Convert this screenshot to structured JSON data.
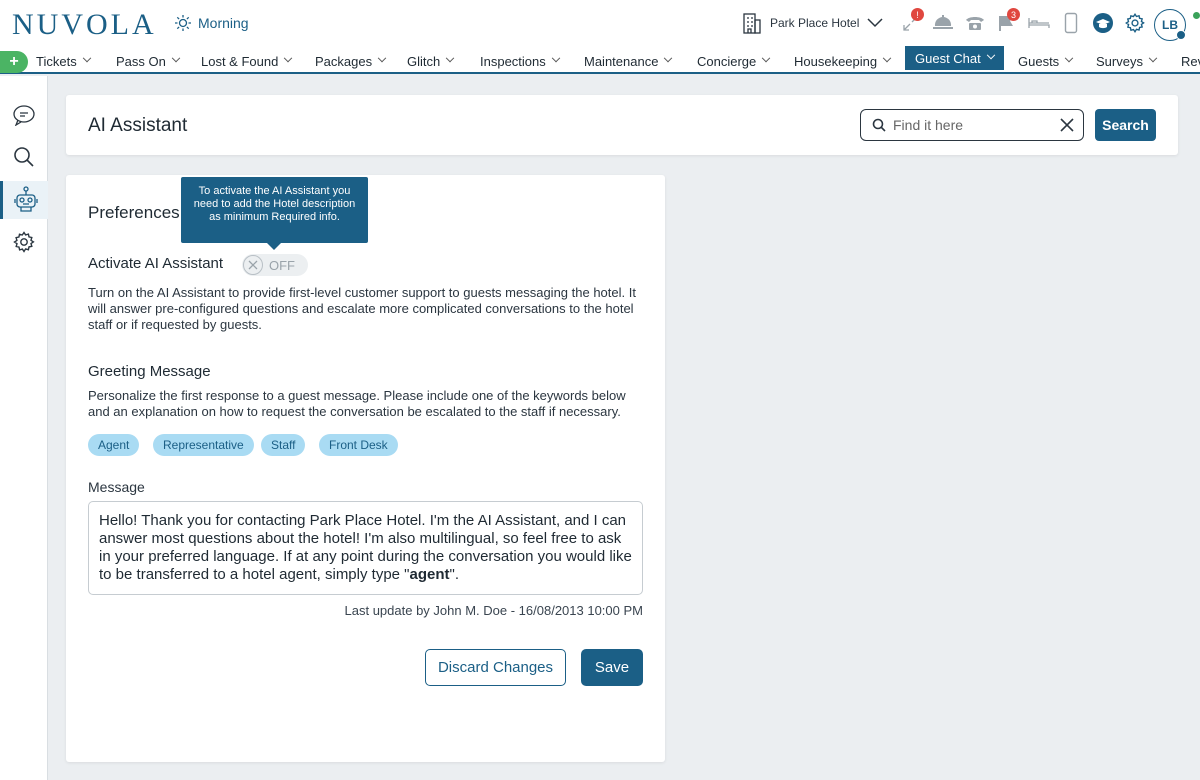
{
  "app": {
    "logo": "NUVOLA",
    "shift": "Morning",
    "hotel": "Park Place Hotel",
    "avatar_initials": "LB"
  },
  "badges": {
    "alerts": "!",
    "messages": "3"
  },
  "nav": {
    "items": [
      "Tickets",
      "Pass On",
      "Lost & Found",
      "Packages",
      "Glitch",
      "Inspections",
      "Maintenance",
      "Concierge",
      "Housekeeping",
      "Guest Chat",
      "Guests",
      "Surveys",
      "Rev"
    ],
    "active": "Guest Chat"
  },
  "header": {
    "title": "AI Assistant",
    "search_placeholder": "Find it here",
    "search_button": "Search"
  },
  "preferences": {
    "title": "Preferences",
    "tooltip": "To activate the AI Assistant you need to add the Hotel description as minimum Required info.",
    "activate_label": "Activate AI Assistant",
    "toggle_state": "OFF",
    "description": "Turn on the AI Assistant to provide first-level customer support to guests messaging the hotel. It will answer pre-configured questions and escalate more complicated conversations to the hotel staff or if requested by guests."
  },
  "greeting": {
    "title": "Greeting Message",
    "description": "Personalize the first response to a guest message. Please include one of the keywords below and an explanation on how to request the conversation be escalated to the staff if necessary.",
    "keywords": [
      "Agent",
      "Representative",
      "Staff",
      "Front Desk"
    ],
    "message_label": "Message",
    "message_text": "Hello! Thank you for contacting Park Place Hotel. I'm the AI Assistant, and I can answer most questions about the hotel! I'm also multilingual, so feel free to ask in your preferred language. If at any point during the conversation you would like to be transferred to a hotel agent, simply type \"",
    "message_keyword": "agent",
    "message_end": "\".",
    "last_update": "Last update by John M. Doe - 16/08/2013 10:00 PM"
  },
  "actions": {
    "discard": "Discard Changes",
    "save": "Save"
  },
  "colors": {
    "primary": "#1b5f86",
    "chip": "#a9dbf3",
    "plus": "#4bb464",
    "badge": "#e0473f"
  }
}
